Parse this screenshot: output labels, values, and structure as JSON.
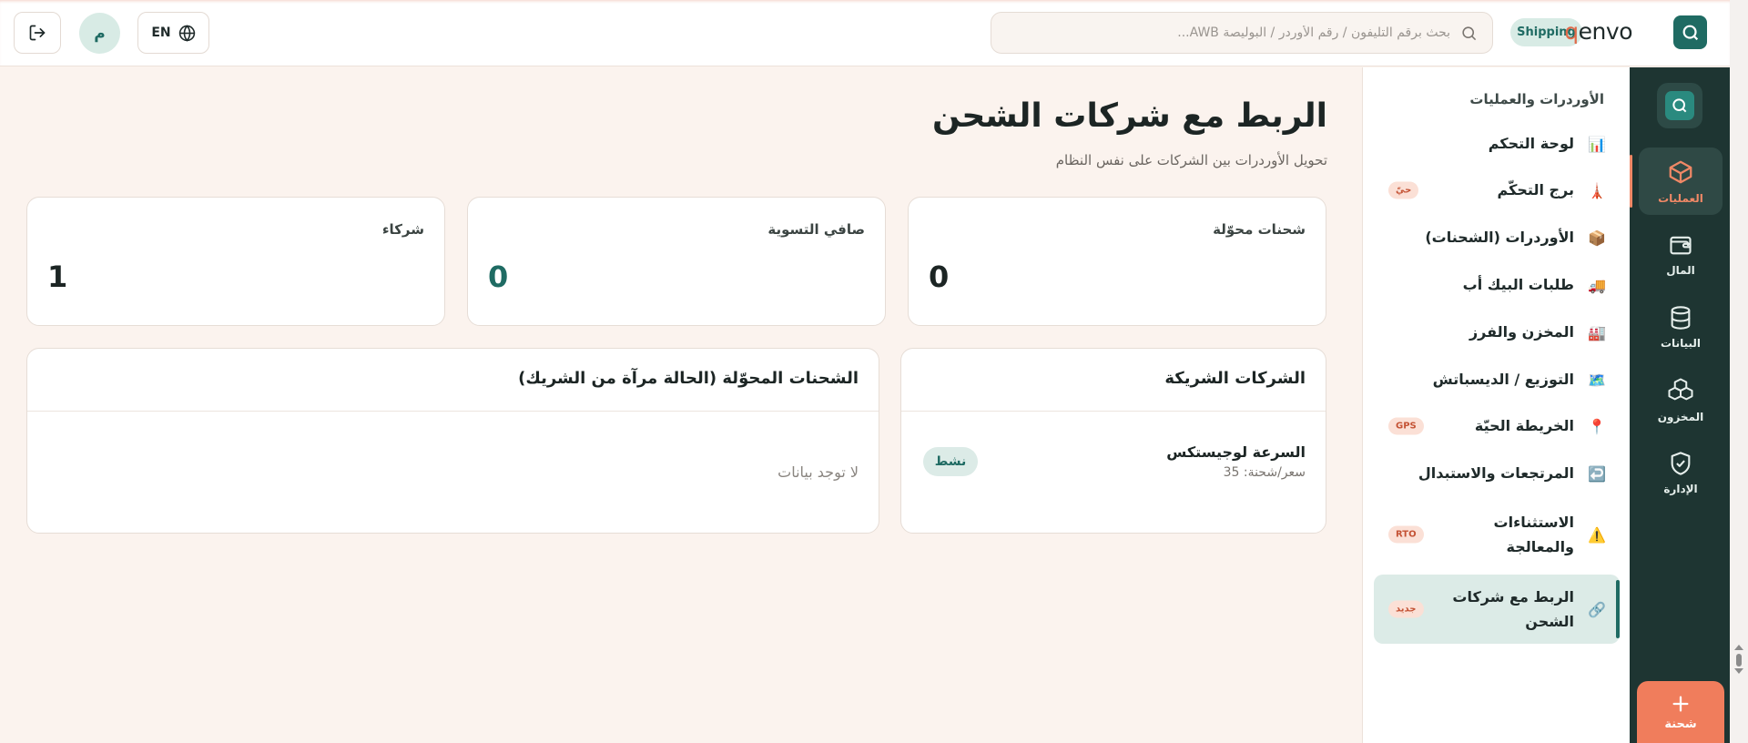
{
  "header": {
    "brand": "qenvo",
    "brand_accent": "q",
    "brand_rest": "envo",
    "mode_pill": "Shipping",
    "search_placeholder": "بحث برقم التليفون / رقم الأوردر / البوليصة AWB...",
    "user_initial": "م",
    "lang_label": "EN"
  },
  "rail": {
    "items": [
      {
        "label": "العمليات",
        "icon": "box-icon",
        "active": true
      },
      {
        "label": "المال",
        "icon": "wallet-icon",
        "active": false
      },
      {
        "label": "البيانات",
        "icon": "database-icon",
        "active": false
      },
      {
        "label": "المخزون",
        "icon": "boxes-icon",
        "active": false
      },
      {
        "label": "الإدارة",
        "icon": "shield-check-icon",
        "active": false
      }
    ],
    "fab_label": "شحنة"
  },
  "sidebar": {
    "section_title": "الأوردرات والعمليات",
    "items": [
      {
        "label": "لوحة التحكم",
        "icon": "📊",
        "badge": ""
      },
      {
        "label": "برج التحكّم",
        "icon": "🗼",
        "badge": "حيّ"
      },
      {
        "label": "الأوردرات (الشحنات)",
        "icon": "📦",
        "badge": ""
      },
      {
        "label": "طلبات البيك أب",
        "icon": "🚚",
        "badge": ""
      },
      {
        "label": "المخزن والفرز",
        "icon": "🏭",
        "badge": ""
      },
      {
        "label": "التوزيع / الديسباتش",
        "icon": "🗺️",
        "badge": ""
      },
      {
        "label": "الخريطة الحيّة",
        "icon": "📍",
        "badge": "GPS"
      },
      {
        "label": "المرتجعات والاستبدال",
        "icon": "↩️",
        "badge": ""
      },
      {
        "label": "الاستثناءات والمعالجة",
        "icon": "⚠️",
        "badge": "RTO"
      },
      {
        "label": "الربط مع شركات الشحن",
        "icon": "🔗",
        "badge": "جديد",
        "active": true
      }
    ]
  },
  "main": {
    "title": "الربط مع شركات الشحن",
    "subtitle": "تحويل الأوردرات بين الشركات على نفس النظام",
    "stats": [
      {
        "label": "شحنات محوّلة",
        "value": "0",
        "color": "#1c2524"
      },
      {
        "label": "صافي التسوية",
        "value": "0",
        "color": "#1f6b63"
      },
      {
        "label": "شركاء",
        "value": "1",
        "color": "#1c2524"
      }
    ],
    "partners_panel": {
      "title": "الشركات الشريكة",
      "partner_name": "السرعة لوجيستكس",
      "partner_meta": "سعر/شحنة: 35",
      "status": "نشط"
    },
    "transfers_panel": {
      "title": "الشحنات المحوّلة (الحالة مرآة من الشريك)",
      "empty": "لا توجد بيانات"
    }
  },
  "colors": {
    "brand_teal": "#1f6b63",
    "accent_coral": "#f07d5c",
    "rail_bg": "#1e3532",
    "page_bg": "#fbf3ee"
  }
}
